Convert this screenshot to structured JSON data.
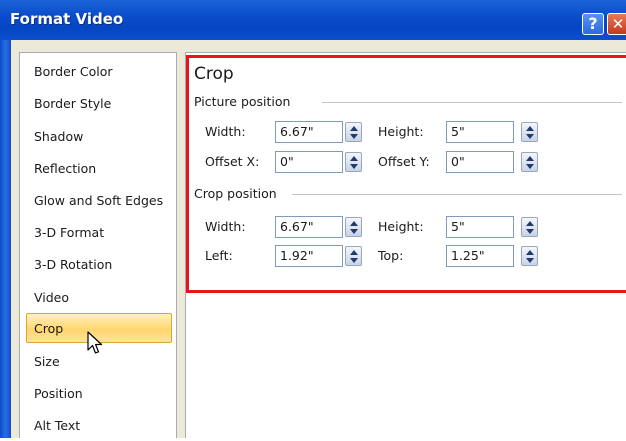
{
  "window": {
    "title": "Format Video",
    "help_glyph": "?",
    "close_glyph": "✕"
  },
  "sidebar": {
    "items": [
      {
        "label": "Border Color"
      },
      {
        "label": "Border Style"
      },
      {
        "label": "Shadow"
      },
      {
        "label": "Reflection"
      },
      {
        "label": "Glow and Soft Edges"
      },
      {
        "label": "3-D Format"
      },
      {
        "label": "3-D Rotation"
      },
      {
        "label": "Video"
      },
      {
        "label": "Crop",
        "selected": true
      },
      {
        "label": "Size"
      },
      {
        "label": "Position"
      },
      {
        "label": "Alt Text"
      }
    ]
  },
  "crop": {
    "title": "Crop",
    "picture_position": {
      "label": "Picture position",
      "width_label": "Width:",
      "width_value": "6.67\"",
      "height_label": "Height:",
      "height_value": "5\"",
      "offset_x_label": "Offset X:",
      "offset_x_value": "0\"",
      "offset_y_label": "Offset Y:",
      "offset_y_value": "0\""
    },
    "crop_position": {
      "label": "Crop position",
      "width_label": "Width:",
      "width_value": "6.67\"",
      "height_label": "Height:",
      "height_value": "5\"",
      "left_label": "Left:",
      "left_value": "1.92\"",
      "top_label": "Top:",
      "top_value": "1.25\""
    }
  },
  "colors": {
    "titlebar": "#0a4ccb",
    "highlight_box": "#e8161c",
    "selected_item": "#ffd66e"
  }
}
